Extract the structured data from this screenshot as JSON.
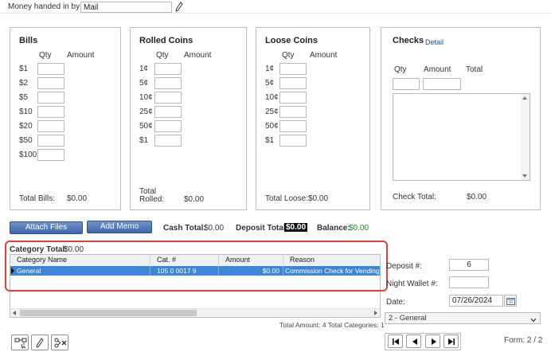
{
  "top": {
    "money_label": "Money handed in by:",
    "money_value": "Mail"
  },
  "bills": {
    "title": "Bills",
    "qty_label": "Qty",
    "amount_label": "Amount",
    "denominations": [
      "$1",
      "$2",
      "$5",
      "$10",
      "$20",
      "$50",
      "$100"
    ],
    "total_label": "Total Bills:",
    "total_value": "$0.00"
  },
  "rolled": {
    "title": "Rolled Coins",
    "qty_label": "Qty",
    "amount_label": "Amount",
    "denominations": [
      "1¢",
      "5¢",
      "10¢",
      "25¢",
      "50¢",
      "$1"
    ],
    "total_label_1": "Total",
    "total_label_2": "Rolled:",
    "total_value": "$0.00"
  },
  "loose": {
    "title": "Loose Coins",
    "qty_label": "Qty",
    "amount_label": "Amount",
    "denominations": [
      "1¢",
      "5¢",
      "10¢",
      "25¢",
      "50¢",
      "$1"
    ],
    "total_label": "Total Loose:",
    "total_value": "$0.00"
  },
  "checks": {
    "title": "Checks",
    "detail_link": "Detail",
    "qty_label": "Qty",
    "amount_label": "Amount",
    "total_label": "Total",
    "check_total_label": "Check Total:",
    "check_total_value": "$0.00"
  },
  "actions": {
    "attach_files": "Attach Files",
    "add_memo": "Add Memo",
    "cash_total_label": "Cash Total:",
    "cash_total_value": "$0.00",
    "deposit_total_label": "Deposit Total:",
    "deposit_total_value": "$0.00",
    "balance_label": "Balance:",
    "balance_value": "$0.00"
  },
  "category": {
    "total_label": "Category Total:",
    "total_value": "$0.00",
    "columns": [
      "Category Name",
      "Cat. #",
      "Amount",
      "Reason"
    ],
    "rows": [
      {
        "name": "General",
        "cat": "105 0 0017 9",
        "amount": "$0.00",
        "reason": "Commission Check for Vending"
      }
    ],
    "footer": "Total Amount: 4 Total Categories: 1"
  },
  "right": {
    "deposit_label": "Deposit #:",
    "deposit_value": "6",
    "night_wallet_label": "Night Wallet #:",
    "night_wallet_value": "",
    "date_label": "Date:",
    "date_value": "07/26/2024",
    "dropdown_value": "2 - General",
    "form_label": "Form: 2 / 2"
  },
  "colors": {
    "selection": "#3b86d8",
    "highlight": "#e0403d",
    "button": "#4a72b0",
    "balance": "#1f8a2c"
  }
}
